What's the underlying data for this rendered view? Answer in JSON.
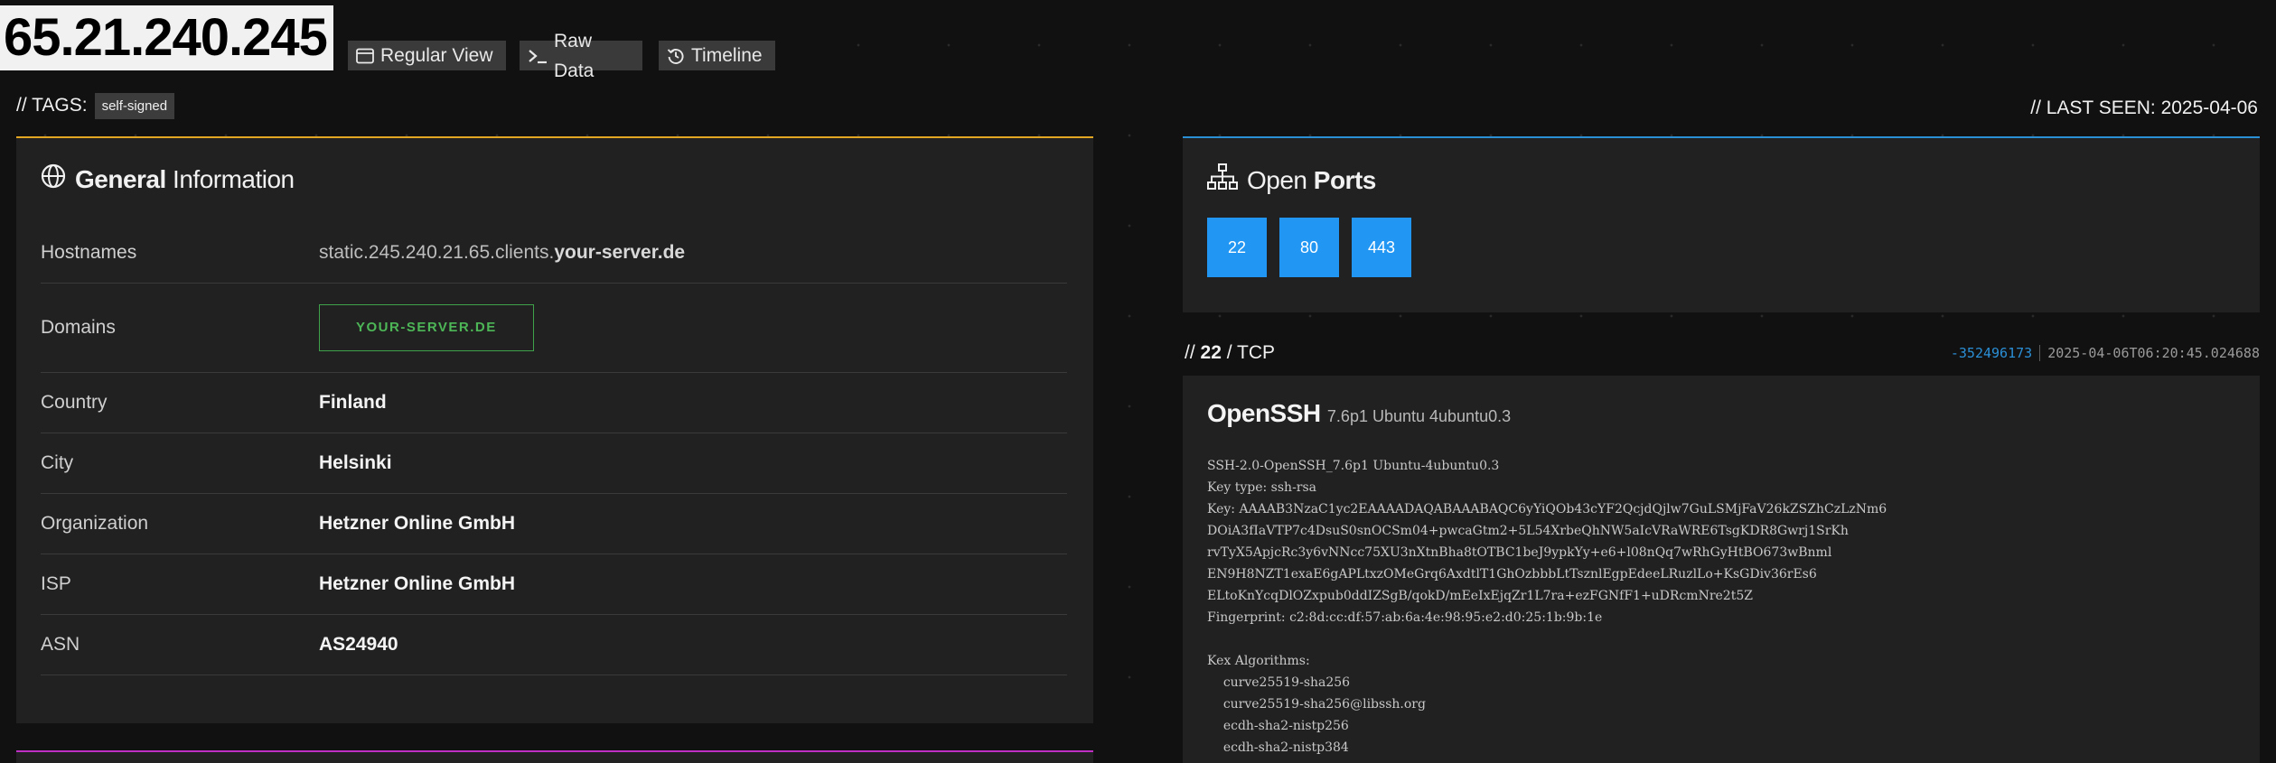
{
  "header": {
    "ip": "65.21.240.245",
    "buttons": {
      "regular_view": "Regular View",
      "raw_data": "Raw Data",
      "timeline": "Timeline"
    }
  },
  "tags": {
    "label": "// TAGS:",
    "items": [
      "self-signed"
    ]
  },
  "last_seen": "// LAST SEEN: 2025-04-06",
  "general": {
    "title_bold": "General",
    "title_rest": " Information",
    "rows": {
      "hostnames_label": "Hostnames",
      "hostnames_prefix": "static.245.240.21.65.clients.",
      "hostnames_domain": "your-server.de",
      "domains_label": "Domains",
      "domains_value": "YOUR-SERVER.DE",
      "country_label": "Country",
      "country_value": "Finland",
      "city_label": "City",
      "city_value": "Helsinki",
      "org_label": "Organization",
      "org_value": "Hetzner Online GmbH",
      "isp_label": "ISP",
      "isp_value": "Hetzner Online GmbH",
      "asn_label": "ASN",
      "asn_value": "AS24940"
    }
  },
  "ports": {
    "title_light": "Open ",
    "title_bold": "Ports",
    "list": [
      "22",
      "80",
      "443"
    ]
  },
  "service": {
    "prefix": "// ",
    "port": "22",
    "proto": " / TCP",
    "hash": "-352496173",
    "timestamp": "2025-04-06T06:20:45.024688",
    "product": "OpenSSH",
    "version": "7.6p1 Ubuntu 4ubuntu0.3",
    "banner": "SSH-2.0-OpenSSH_7.6p1 Ubuntu-4ubuntu0.3\nKey type: ssh-rsa\nKey: AAAAB3NzaC1yc2EAAAADAQABAAABAQC6yYiQOb43cYF2QcjdQjlw7GuLSMjFaV26kZSZhCzLzNm6\nDOiA3fIaVTP7c4DsuS0snOCSm04+pwcaGtm2+5L54XrbeQhNW5aIcVRaWRE6TsgKDR8Gwrj1SrKh\nrvTyX5ApjcRc3y6vNNcc75XU3nXtnBha8tOTBC1beJ9ypkYy+e6+l08nQq7wRhGyHtBO673wBnml\nEN9H8NZT1exaE6gAPLtxzOMeGrq6AxdtlT1GhOzbbbLtTsznlEgpEdeeLRuzlLo+KsGDiv36rEs6\nELtoKnYcqDlOZxpub0ddIZSgB/qokD/mEeIxEjqZr1L7ra+ezFGNfF1+uDRcmNre2t5Z\nFingerprint: c2:8d:cc:df:57:ab:6a:4e:98:95:e2:d0:25:1b:9b:1e\n\nKex Algorithms:\n\tcurve25519-sha256\n\tcurve25519-sha256@libssh.org\n\tecdh-sha2-nistp256\n\tecdh-sha2-nistp384"
  }
}
